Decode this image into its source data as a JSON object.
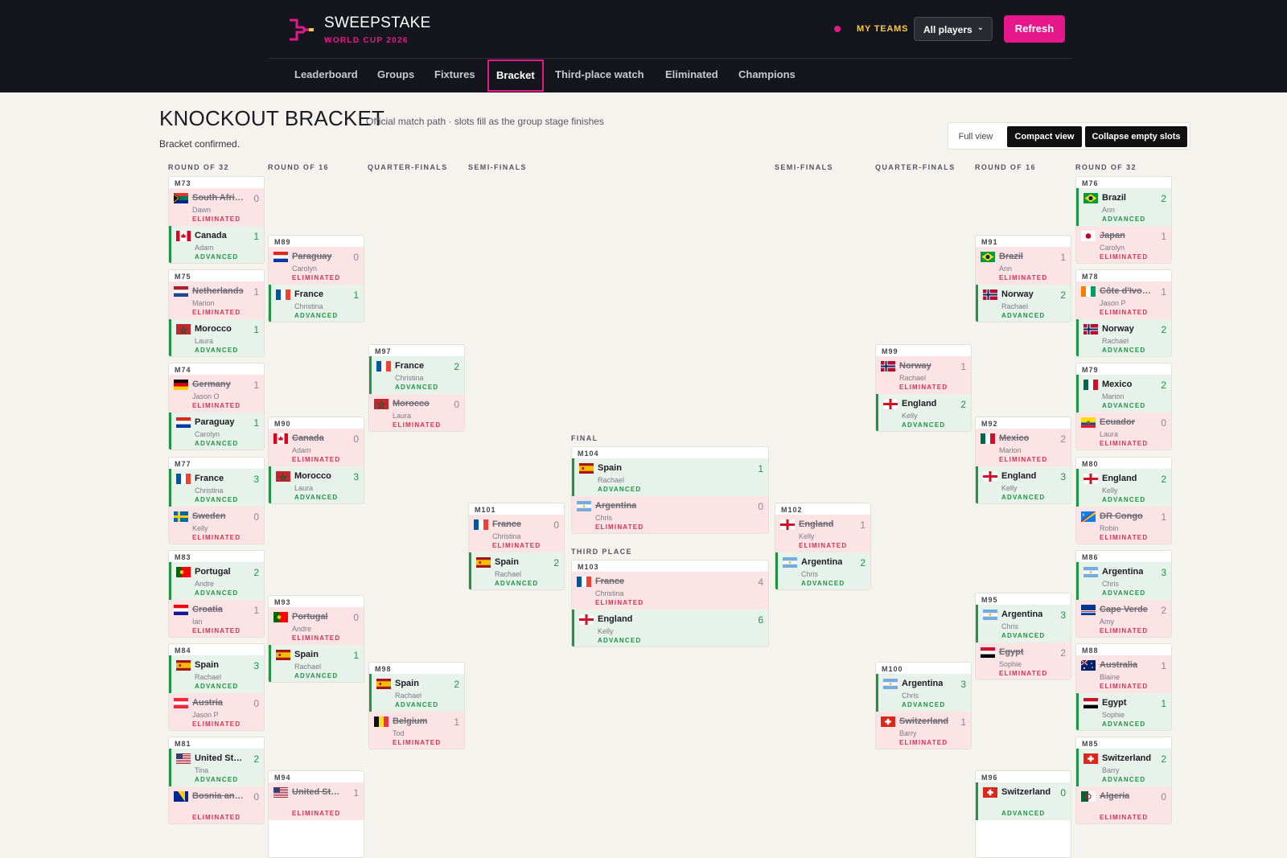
{
  "header": {
    "brand_name": "SWEEPSTAKE",
    "brand_sub": "WORLD CUP 2026",
    "my_teams": "MY TEAMS",
    "players_select": "All players",
    "refresh": "Refresh",
    "accent": "#e5178a"
  },
  "nav": [
    "Leaderboard",
    "Groups",
    "Fixtures",
    "Bracket",
    "Third-place watch",
    "Eliminated",
    "Champions"
  ],
  "nav_active": "Bracket",
  "page": {
    "title": "KNOCKOUT BRACKET",
    "subtitle": "Official match path · slots fill as the group stage finishes",
    "status": "Bracket confirmed.",
    "views": [
      "Full view",
      "Compact view",
      "Collapse empty slots"
    ]
  },
  "round_labels": {
    "r32": "ROUND OF 32",
    "r16": "ROUND OF 16",
    "qf": "QUARTER-FINALS",
    "sf": "SEMI-FINALS",
    "final": "FINAL",
    "third": "THIRD PLACE"
  },
  "status_labels": {
    "adv": "ADVANCED",
    "elim": "ELIMINATED"
  },
  "matches": [
    {
      "id": "M73",
      "teams": [
        {
          "name": "South Africa",
          "owner": "Dawn",
          "score": 0,
          "adv": false,
          "flag": "za"
        },
        {
          "name": "Canada",
          "owner": "Adam",
          "score": 1,
          "adv": true,
          "flag": "ca"
        }
      ]
    },
    {
      "id": "M75",
      "teams": [
        {
          "name": "Netherlands",
          "owner": "Marion",
          "score": 1,
          "adv": false,
          "flag": "nl"
        },
        {
          "name": "Morocco",
          "owner": "Laura",
          "score": 1,
          "adv": true,
          "flag": "ma"
        }
      ]
    },
    {
      "id": "M74",
      "teams": [
        {
          "name": "Germany",
          "owner": "Jason O",
          "score": 1,
          "adv": false,
          "flag": "de"
        },
        {
          "name": "Paraguay",
          "owner": "Carolyn",
          "score": 1,
          "adv": true,
          "flag": "py"
        }
      ]
    },
    {
      "id": "M77",
      "teams": [
        {
          "name": "France",
          "owner": "Christina",
          "score": 3,
          "adv": true,
          "flag": "fr"
        },
        {
          "name": "Sweden",
          "owner": "Kelly",
          "score": 0,
          "adv": false,
          "flag": "se"
        }
      ]
    },
    {
      "id": "M83",
      "teams": [
        {
          "name": "Portugal",
          "owner": "Andre",
          "score": 2,
          "adv": true,
          "flag": "pt"
        },
        {
          "name": "Croatia",
          "owner": "Ian",
          "score": 1,
          "adv": false,
          "flag": "hr"
        }
      ]
    },
    {
      "id": "M84",
      "teams": [
        {
          "name": "Spain",
          "owner": "Rachael",
          "score": 3,
          "adv": true,
          "flag": "es"
        },
        {
          "name": "Austria",
          "owner": "Jason P",
          "score": 0,
          "adv": false,
          "flag": "at"
        }
      ]
    },
    {
      "id": "M81",
      "teams": [
        {
          "name": "United States",
          "owner": "Tina",
          "score": 2,
          "adv": true,
          "flag": "us"
        },
        {
          "name": "Bosnia and Herzegovina",
          "owner": "",
          "score": 0,
          "adv": false,
          "flag": "ba"
        }
      ]
    },
    {
      "id": "M89",
      "teams": [
        {
          "name": "Paraguay",
          "owner": "Carolyn",
          "score": 0,
          "adv": false,
          "flag": "py"
        },
        {
          "name": "France",
          "owner": "Christina",
          "score": 1,
          "adv": true,
          "flag": "fr"
        }
      ]
    },
    {
      "id": "M90",
      "teams": [
        {
          "name": "Canada",
          "owner": "Adam",
          "score": 0,
          "adv": false,
          "flag": "ca"
        },
        {
          "name": "Morocco",
          "owner": "Laura",
          "score": 3,
          "adv": true,
          "flag": "ma"
        }
      ]
    },
    {
      "id": "M93",
      "teams": [
        {
          "name": "Portugal",
          "owner": "Andre",
          "score": 0,
          "adv": false,
          "flag": "pt"
        },
        {
          "name": "Spain",
          "owner": "Rachael",
          "score": 1,
          "adv": true,
          "flag": "es"
        }
      ]
    },
    {
      "id": "M94",
      "teams": [
        {
          "name": "United States",
          "owner": "",
          "score": 1,
          "adv": false,
          "flag": "us"
        }
      ]
    },
    {
      "id": "M97",
      "teams": [
        {
          "name": "France",
          "owner": "Christina",
          "score": 2,
          "adv": true,
          "flag": "fr"
        },
        {
          "name": "Morocco",
          "owner": "Laura",
          "score": 0,
          "adv": false,
          "flag": "ma"
        }
      ]
    },
    {
      "id": "M98",
      "teams": [
        {
          "name": "Spain",
          "owner": "Rachael",
          "score": 2,
          "adv": true,
          "flag": "es"
        },
        {
          "name": "Belgium",
          "owner": "Tod",
          "score": 1,
          "adv": false,
          "flag": "be"
        }
      ]
    },
    {
      "id": "M101",
      "teams": [
        {
          "name": "France",
          "owner": "Christina",
          "score": 0,
          "adv": false,
          "flag": "fr"
        },
        {
          "name": "Spain",
          "owner": "Rachael",
          "score": 2,
          "adv": true,
          "flag": "es"
        }
      ]
    },
    {
      "id": "M104",
      "teams": [
        {
          "name": "Spain",
          "owner": "Rachael",
          "score": 1,
          "adv": true,
          "flag": "es"
        },
        {
          "name": "Argentina",
          "owner": "Chris",
          "score": 0,
          "adv": false,
          "flag": "ar"
        }
      ]
    },
    {
      "id": "M103",
      "teams": [
        {
          "name": "France",
          "owner": "Christina",
          "score": 4,
          "adv": false,
          "flag": "fr"
        },
        {
          "name": "England",
          "owner": "Kelly",
          "score": 6,
          "adv": true,
          "flag": "en"
        }
      ]
    },
    {
      "id": "M102",
      "teams": [
        {
          "name": "England",
          "owner": "Kelly",
          "score": 1,
          "adv": false,
          "flag": "en"
        },
        {
          "name": "Argentina",
          "owner": "Chris",
          "score": 2,
          "adv": true,
          "flag": "ar"
        }
      ]
    },
    {
      "id": "M99",
      "teams": [
        {
          "name": "Norway",
          "owner": "Rachael",
          "score": 1,
          "adv": false,
          "flag": "no"
        },
        {
          "name": "England",
          "owner": "Kelly",
          "score": 2,
          "adv": true,
          "flag": "en"
        }
      ]
    },
    {
      "id": "M100",
      "teams": [
        {
          "name": "Argentina",
          "owner": "Chris",
          "score": 3,
          "adv": true,
          "flag": "ar"
        },
        {
          "name": "Switzerland",
          "owner": "Barry",
          "score": 1,
          "adv": false,
          "flag": "ch"
        }
      ]
    },
    {
      "id": "M91",
      "teams": [
        {
          "name": "Brazil",
          "owner": "Ann",
          "score": 1,
          "adv": false,
          "flag": "br"
        },
        {
          "name": "Norway",
          "owner": "Rachael",
          "score": 2,
          "adv": true,
          "flag": "no"
        }
      ]
    },
    {
      "id": "M92",
      "teams": [
        {
          "name": "Mexico",
          "owner": "Marion",
          "score": 2,
          "adv": false,
          "flag": "mx"
        },
        {
          "name": "England",
          "owner": "Kelly",
          "score": 3,
          "adv": true,
          "flag": "en"
        }
      ]
    },
    {
      "id": "M95",
      "teams": [
        {
          "name": "Argentina",
          "owner": "Chris",
          "score": 3,
          "adv": true,
          "flag": "ar"
        },
        {
          "name": "Egypt",
          "owner": "Sophie",
          "score": 2,
          "adv": false,
          "flag": "eg"
        }
      ]
    },
    {
      "id": "M96",
      "teams": [
        {
          "name": "Switzerland",
          "owner": "",
          "score": 0,
          "adv": true,
          "flag": "ch"
        }
      ]
    },
    {
      "id": "M76",
      "teams": [
        {
          "name": "Brazil",
          "owner": "Ann",
          "score": 2,
          "adv": true,
          "flag": "br"
        },
        {
          "name": "Japan",
          "owner": "Carolyn",
          "score": 1,
          "adv": false,
          "flag": "jp"
        }
      ]
    },
    {
      "id": "M78",
      "teams": [
        {
          "name": "Côte d'Ivoire",
          "owner": "Jason P",
          "score": 1,
          "adv": false,
          "flag": "ci"
        },
        {
          "name": "Norway",
          "owner": "Rachael",
          "score": 2,
          "adv": true,
          "flag": "no"
        }
      ]
    },
    {
      "id": "M79",
      "teams": [
        {
          "name": "Mexico",
          "owner": "Marion",
          "score": 2,
          "adv": true,
          "flag": "mx"
        },
        {
          "name": "Ecuador",
          "owner": "Laura",
          "score": 0,
          "adv": false,
          "flag": "ec"
        }
      ]
    },
    {
      "id": "M80",
      "teams": [
        {
          "name": "England",
          "owner": "Kelly",
          "score": 2,
          "adv": true,
          "flag": "en"
        },
        {
          "name": "DR Congo",
          "owner": "Robin",
          "score": 1,
          "adv": false,
          "flag": "cd"
        }
      ]
    },
    {
      "id": "M86",
      "teams": [
        {
          "name": "Argentina",
          "owner": "Chris",
          "score": 3,
          "adv": true,
          "flag": "ar"
        },
        {
          "name": "Cape Verde",
          "owner": "Amy",
          "score": 2,
          "adv": false,
          "flag": "cv"
        }
      ]
    },
    {
      "id": "M88",
      "teams": [
        {
          "name": "Australia",
          "owner": "Blaine",
          "score": 1,
          "adv": false,
          "flag": "au"
        },
        {
          "name": "Egypt",
          "owner": "Sophie",
          "score": 1,
          "adv": true,
          "flag": "eg"
        }
      ]
    },
    {
      "id": "M85",
      "teams": [
        {
          "name": "Switzerland",
          "owner": "Barry",
          "score": 2,
          "adv": true,
          "flag": "ch"
        },
        {
          "name": "Algeria",
          "owner": "",
          "score": 0,
          "adv": false,
          "flag": "dz"
        }
      ]
    }
  ]
}
